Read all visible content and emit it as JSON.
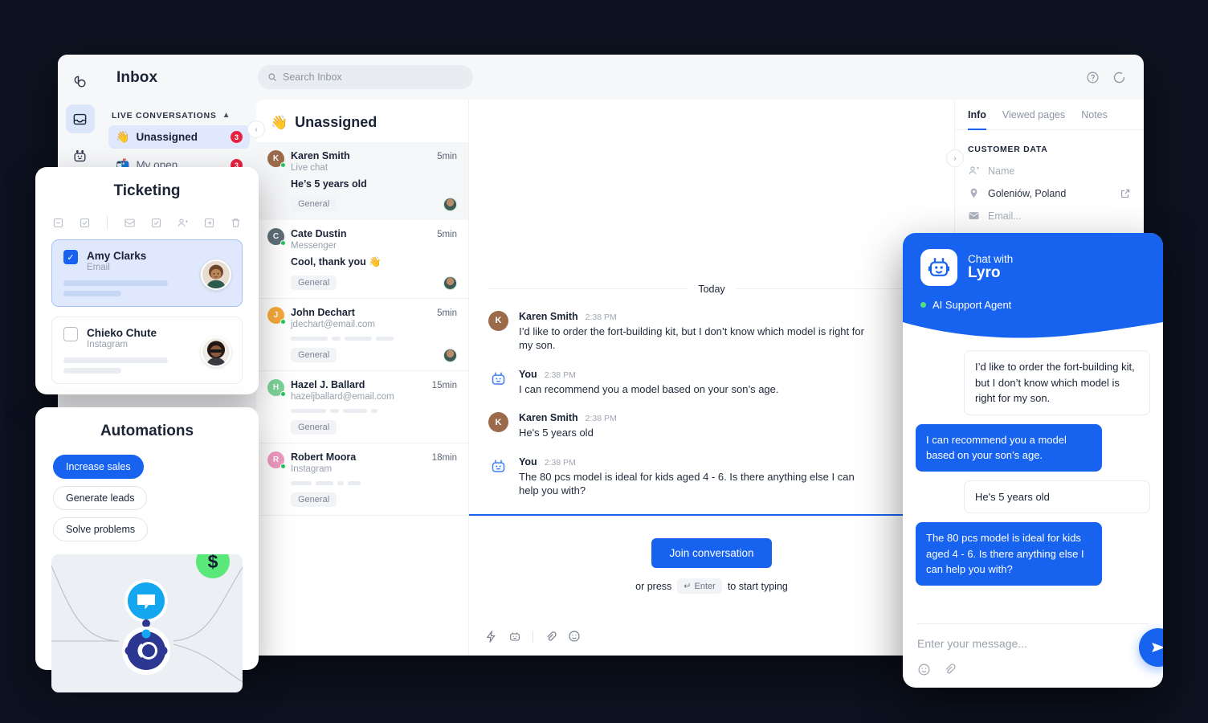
{
  "app": {
    "rail": [
      {
        "name": "logo-icon",
        "label": "Tidio"
      },
      {
        "name": "inbox-icon",
        "label": "Inbox"
      },
      {
        "name": "bot-icon",
        "label": "Lyro AI"
      }
    ],
    "nav_title": "Inbox",
    "section_label": "LIVE CONVERSATIONS",
    "nav_items": [
      {
        "emoji": "👋",
        "label": "Unassigned",
        "badge": "3",
        "active": true
      },
      {
        "emoji": "📬",
        "label": "My open",
        "badge": "3",
        "active": false
      }
    ],
    "search": {
      "placeholder": "Search Inbox",
      "value": ""
    },
    "topbar_icons": [
      "help-icon",
      "sync-icon"
    ]
  },
  "conversations": {
    "header_emoji": "👋",
    "header_title": "Unassigned",
    "items": [
      {
        "initial": "K",
        "color": "#9b6a4a",
        "name": "Karen Smith",
        "channel": "Live chat",
        "time": "5min",
        "preview": "He’s 5 years old",
        "tag": "General",
        "selected": true,
        "has_assignee": true,
        "skeleton": []
      },
      {
        "initial": "C",
        "color": "#5e6e77",
        "name": "Cate Dustin",
        "channel": "Messenger",
        "time": "5min",
        "preview": "Cool, thank you 👋",
        "tag": "General",
        "selected": false,
        "has_assignee": true,
        "skeleton": []
      },
      {
        "initial": "J",
        "color": "#f7a93b",
        "name": "John Dechart",
        "channel": "jdechart@email.com",
        "time": "5min",
        "preview": "",
        "tag": "General",
        "selected": false,
        "has_assignee": true,
        "skeleton": [
          46,
          11,
          34,
          22
        ]
      },
      {
        "initial": "H",
        "color": "#7ed39a",
        "name": "Hazel J. Ballard",
        "channel": "hazeljballard@email.com",
        "time": "15min",
        "preview": "",
        "tag": "General",
        "selected": false,
        "has_assignee": false,
        "skeleton": [
          44,
          11,
          30,
          8
        ]
      },
      {
        "initial": "R",
        "color": "#f09ac0",
        "name": "Robert Moora",
        "channel": "Instagram",
        "time": "18min",
        "preview": "",
        "tag": "General",
        "selected": false,
        "has_assignee": false,
        "skeleton": [
          26,
          22,
          8,
          16
        ]
      }
    ]
  },
  "thread": {
    "day_label": "Today",
    "messages": [
      {
        "author": "Karen Smith",
        "time": "2:38 PM",
        "initial": "K",
        "color": "#9b6a4a",
        "is_bot": false,
        "text": "I’d like to order the fort-building kit, but I don’t know which model is right for my son."
      },
      {
        "author": "You",
        "time": "2:38 PM",
        "initial": "",
        "color": "",
        "is_bot": true,
        "text": "I can recommend you a model based on your son’s age."
      },
      {
        "author": "Karen Smith",
        "time": "2:38 PM",
        "initial": "K",
        "color": "#9b6a4a",
        "is_bot": false,
        "text": "He's 5 years old"
      },
      {
        "author": "You",
        "time": "2:38 PM",
        "initial": "",
        "color": "",
        "is_bot": true,
        "text": "The 80 pcs model is ideal for kids aged 4 - 6. Is there anything else I can help you with?"
      }
    ],
    "composer": {
      "join_label": "Join conversation",
      "hint_before": "or press",
      "kbd_arrow": "↵",
      "kbd_label": "Enter",
      "hint_after": "to start typing",
      "tools": [
        "shortcuts-icon",
        "bot-icon",
        "attachment-icon",
        "emoji-icon"
      ]
    }
  },
  "info_panel": {
    "tabs": [
      {
        "label": "Info",
        "active": true
      },
      {
        "label": "Viewed pages",
        "active": false
      },
      {
        "label": "Notes",
        "active": false
      }
    ],
    "section_title": "CUSTOMER DATA",
    "rows": [
      {
        "icon": "person-add-icon",
        "value": "Name",
        "placeholder": true,
        "external": false
      },
      {
        "icon": "location-pin-icon",
        "value": "Goleniów, Poland",
        "placeholder": false,
        "external": true
      },
      {
        "icon": "envelope-icon",
        "value": "Email...",
        "placeholder": true,
        "external": false
      }
    ]
  },
  "ticketing_card": {
    "title": "Ticketing",
    "tools": [
      "deselect-icon",
      "select-all-icon",
      "mark-unread-icon",
      "mark-done-icon",
      "assign-icon",
      "move-icon",
      "delete-icon"
    ],
    "rows": [
      {
        "name": "Amy Clarks",
        "channel": "Email",
        "checked": true
      },
      {
        "name": "Chieko Chute",
        "channel": "Instagram",
        "checked": false
      }
    ]
  },
  "automations_card": {
    "title": "Automations",
    "chips": [
      {
        "label": "Increase sales",
        "active": true
      },
      {
        "label": "Generate leads",
        "active": false
      },
      {
        "label": "Solve problems",
        "active": false
      }
    ],
    "coin_symbol": "$"
  },
  "lyro_widget": {
    "header_small": "Chat with",
    "header_name": "Lyro",
    "status": "AI Support Agent",
    "messages": [
      {
        "from": "user",
        "text": "I’d like to order the fort-building kit, but I don’t know which model is right for my son."
      },
      {
        "from": "bot",
        "text": "I can recommend you a model based on your son’s age."
      },
      {
        "from": "user",
        "text": "He's 5 years old"
      },
      {
        "from": "bot",
        "text": "The 80 pcs model is ideal for kids aged 4 - 6. Is there anything else I can help you with?"
      }
    ],
    "input_placeholder": "Enter your message...",
    "footer_icons": [
      "emoji-icon",
      "attachment-icon"
    ],
    "send_icon": "send-icon"
  },
  "colors": {
    "brand_blue": "#1763f0",
    "badge_red": "#e8213f",
    "green": "#22c55e",
    "coin_green": "#5ae87b",
    "page_bg": "#0d1220"
  }
}
